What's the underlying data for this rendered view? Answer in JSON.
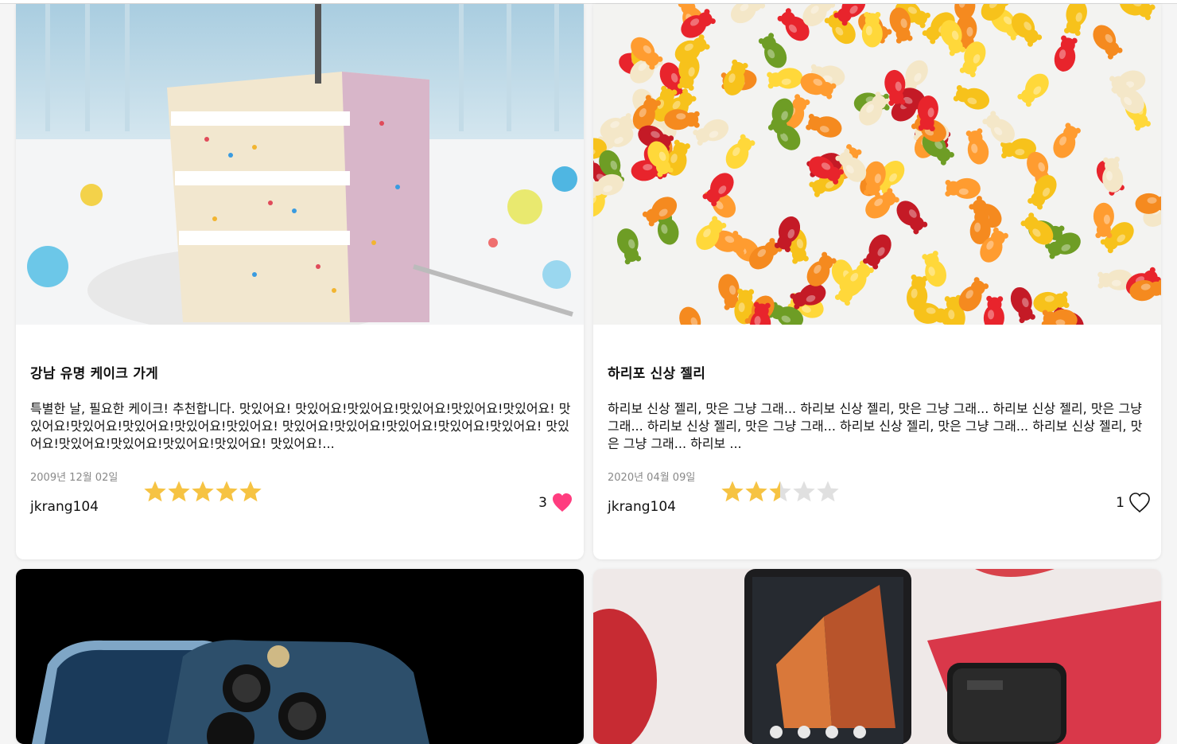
{
  "cards": [
    {
      "title": "강남 유명 케이크 가게",
      "content": "특별한 날, 필요한 케이크! 추천합니다. 맛있어요! 맛있어요!맛있어요!맛있어요!맛있어요!맛있어요! 맛있어요!맛있어요!맛있어요!맛있어요!맛있어요! 맛있어요!맛있어요!맛있어요!맛있어요!맛있어요! 맛있어요!맛있어요!맛있어요!맛있어요!맛있어요! 맛있어요!...",
      "date": "2009년 12월 02일",
      "author": "jkrang104",
      "rating": 5,
      "likes": "3",
      "liked": true,
      "image_icon": "birthday-cake-photo"
    },
    {
      "title": "하리포 신상 젤리",
      "content": "하리보 신상 젤리, 맛은 그냥 그래... 하리보 신상 젤리, 맛은 그냥 그래... 하리보 신상 젤리, 맛은 그냥 그래... 하리보 신상 젤리, 맛은 그냥 그래... 하리보 신상 젤리, 맛은 그냥 그래... 하리보 신상 젤리, 맛은 그냥 그래... 하리보 ...",
      "date": "2020년 04월 09일",
      "author": "jkrang104",
      "rating": 2.5,
      "likes": "1",
      "liked": false,
      "image_icon": "gummy-bears-photo"
    },
    {
      "image_icon": "iphone-photo"
    },
    {
      "image_icon": "galaxy-fold-photo"
    }
  ],
  "colors": {
    "star_filled": "#f6c343",
    "star_empty": "#e0e0e0",
    "heart_filled": "#ff3d7f",
    "text": "#111111",
    "date": "#888888"
  }
}
